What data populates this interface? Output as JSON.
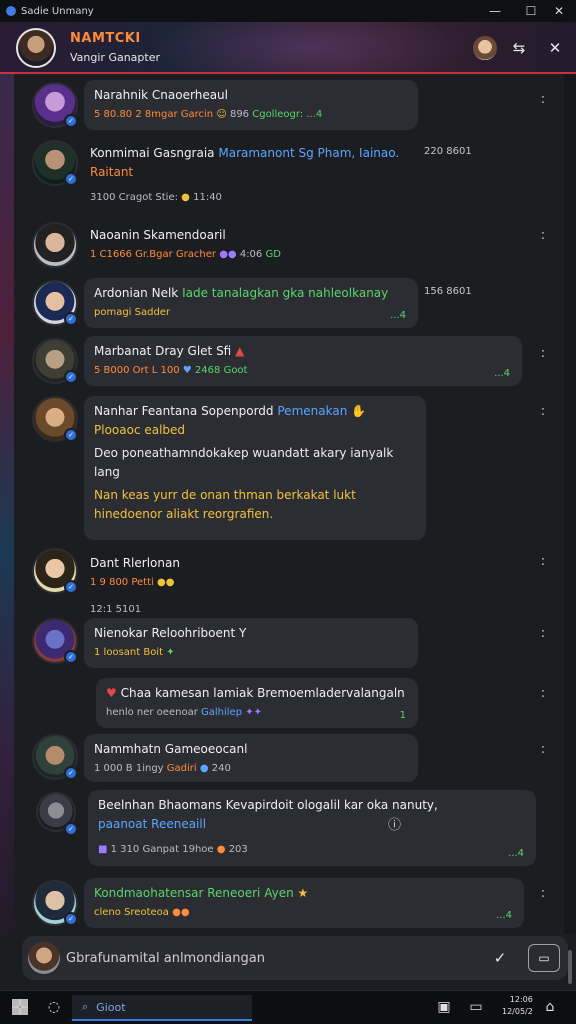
{
  "window": {
    "title": "Sadie Unmany",
    "controls": {
      "minimize": "—",
      "maximize": "☐",
      "close": "✕"
    }
  },
  "header": {
    "title": "NAMTCKI",
    "subtitle": "Vangir Ganapter",
    "icons": [
      "profile-avatar",
      "share-icon",
      "close-icon"
    ]
  },
  "messages": [
    {
      "name": "Narahnik Cnaoerheaul",
      "meta_prefix": "5 80.80 2 8mgar Garcin",
      "meta_suffix": "896",
      "meta_accent": "Cgolleogr: ...4",
      "time": ""
    },
    {
      "name": "Konmimai Gasngraia",
      "name_link": "Maramanont Sg Pham, Iainao.",
      "line2": "Raitant",
      "meta_prefix": "3100 Cragot Stie:",
      "meta_suffix": "11:40",
      "time": "220 8601"
    },
    {
      "name": "Naoanin Skamendoaril",
      "meta_prefix": "1 C1666 Gr.Bgar Gracher",
      "meta_suffix": "4:06",
      "meta_accent": "GD",
      "time": ""
    },
    {
      "name": "Ardonian Nelk",
      "name_link": "Iade tanalagkan gka nahleolkanay",
      "line2": "pomagi Sadder",
      "check": "...4",
      "time": "156 8601"
    },
    {
      "name": "Marbanat Dray Glet Sfi",
      "meta_prefix": "5 B000 Ort L 100",
      "meta_suffix": "2468 Goot",
      "check": "...4",
      "time": ""
    },
    {
      "name": "Nanhar Feantana Sopenpordd",
      "name_link": "Pemenakan",
      "line2": "Plooaoc ealbed",
      "body1": "Deo poneathamndokakep wuandatt akary ianyalk lang",
      "body2": "Nan keas yurr de onan thman berkakat lukt hinedoenor aliakt reorgrafien.",
      "time": ""
    },
    {
      "name": "Dant Rlerlonan",
      "meta_prefix": "1 9 800 Petti",
      "line2": "12:1 5101",
      "time": ""
    },
    {
      "name": "Nienokar Reloohriboent Y",
      "meta_prefix": "1 loosant Boit",
      "time": ""
    },
    {
      "name": "Chaa kamesan lamiak Bremoemladervalangaln",
      "line2_prefix": "henlo ner oeenoar",
      "line2_link": "Galhilep",
      "check": "1",
      "time": ""
    },
    {
      "name": "Nammhatn Gameoeocanl",
      "meta_prefix": "1 000 B 1ingy",
      "meta_accent": "Gadiri",
      "meta_suffix": "240",
      "time": ""
    },
    {
      "name": "Beelnhan Bhaomans Kevapirdoit ologalil kar oka nanuty,",
      "line2": "paanoat Reeneaill",
      "meta_prefix": "1 310 Ganpat 19hoe",
      "meta_suffix": "203",
      "check": "...4",
      "time": ""
    },
    {
      "name": "Kondmaohatensar Reneoeri Ayen",
      "meta_prefix": "cleno Sreoteoa",
      "check": "...4",
      "time": ""
    }
  ],
  "composer": {
    "placeholder": "Gbrafunamital anlmondiangan",
    "mic_icon": "mic-icon",
    "send_icon": "send-icon"
  },
  "taskbar": {
    "search_label": "Gioot",
    "clock_line1": "12:06",
    "clock_line2": "12/05/2",
    "icons": [
      "start-icon",
      "chat-icon",
      "search-icon",
      "window-icon",
      "monitor-icon",
      "wifi-icon"
    ]
  },
  "colors": {
    "accent_orange": "#ff8b3d",
    "accent_green": "#58d66a",
    "accent_blue": "#58a6ff",
    "header_border": "#c8323a",
    "bubble_bg": "#2c2d32"
  }
}
